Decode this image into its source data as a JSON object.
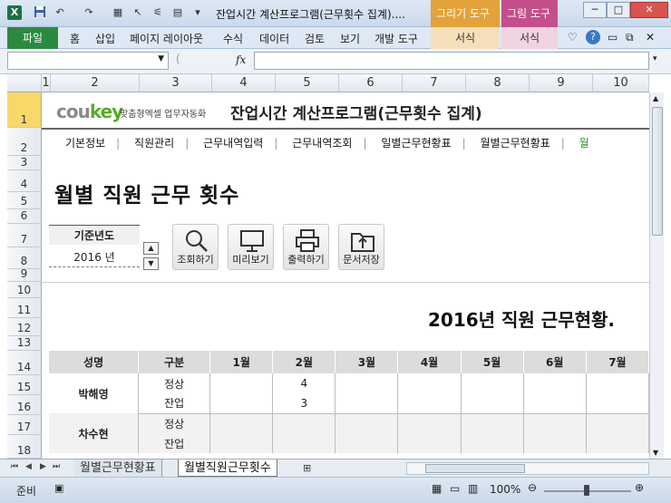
{
  "window": {
    "title": "잔업시간 계산프로그램(근무횟수 집계)....",
    "context_tab_drawing": "그리기 도구",
    "context_tab_picture": "그림 도구",
    "context_sub_format_1": "서식",
    "context_sub_format_2": "서식"
  },
  "ribbon": {
    "file": "파일",
    "tabs": [
      "홈",
      "삽입",
      "페이지 레이아웃",
      "수식",
      "데이터",
      "검토",
      "보기",
      "개발 도구"
    ]
  },
  "formula_bar": {
    "fx": "fx",
    "name_box": "",
    "formula": ""
  },
  "columns": [
    "1",
    "2",
    "3",
    "4",
    "5",
    "6",
    "7",
    "8",
    "9",
    "10"
  ],
  "rows": [
    "1",
    "2",
    "3",
    "4",
    "5",
    "6",
    "7",
    "8",
    "9",
    "10",
    "11",
    "12",
    "13",
    "14",
    "15",
    "16",
    "17",
    "18"
  ],
  "header": {
    "brand_prefix": "cou",
    "brand_suffix": "key",
    "brand_sub": "맞춤형엑셀 업무자동화",
    "app_title": "잔업시간 계산프로그램(근무횟수 집계)"
  },
  "nav": {
    "items": [
      "기본정보",
      "직원관리",
      "근무내역입력",
      "근무내역조회",
      "일별근무현황표",
      "월별근무현황표"
    ],
    "active_partial": "월"
  },
  "page_title": "월별 직원 근무 횟수",
  "year": {
    "label": "기준년도",
    "value": "2016 년"
  },
  "buttons": {
    "search": "조회하기",
    "preview": "미리보기",
    "print": "출력하기",
    "save": "문서저장"
  },
  "report_title": "2016년 직원 근무현황.",
  "table": {
    "headers": [
      "성명",
      "구분",
      "1월",
      "2월",
      "3월",
      "4월",
      "5월",
      "6월",
      "7월"
    ],
    "rows": [
      {
        "name": "박해영",
        "type": "정상",
        "months": [
          "",
          "4",
          "",
          "",
          "",
          "",
          ""
        ]
      },
      {
        "name": "",
        "type": "잔업",
        "months": [
          "",
          "3",
          "",
          "",
          "",
          "",
          ""
        ]
      },
      {
        "name": "차수현",
        "type": "정상",
        "months": [
          "",
          "",
          "",
          "",
          "",
          "",
          ""
        ]
      },
      {
        "name": "",
        "type": "잔업",
        "months": [
          "",
          "",
          "",
          "",
          "",
          "",
          ""
        ]
      }
    ]
  },
  "sheet_tabs": [
    "월별근무현황표",
    "월별직원근무횟수"
  ],
  "status": {
    "ready": "준비",
    "zoom": "100%"
  }
}
